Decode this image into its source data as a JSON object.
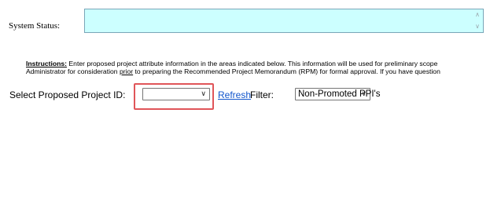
{
  "system_status": {
    "label": "System Status:",
    "value": ""
  },
  "instructions": {
    "heading": "Instructions:",
    "line1_text": " Enter proposed project attribute information in the areas indicated below. This information will be used for preliminary scope",
    "line2_before": "Administrator for consideration ",
    "line2_prior": "prior",
    "line2_after": " to preparing the Recommended Project Memorandum (RPM) for formal approval. If you have question"
  },
  "project_select": {
    "label": "Select Proposed Project ID:",
    "selected": ""
  },
  "refresh": {
    "label": "Refresh"
  },
  "filter": {
    "label": "Filter:",
    "selected": "Non-Promoted PPI's"
  },
  "colors": {
    "status_bg": "#ccffff",
    "highlight": "#e05559",
    "link": "#1155cc"
  }
}
